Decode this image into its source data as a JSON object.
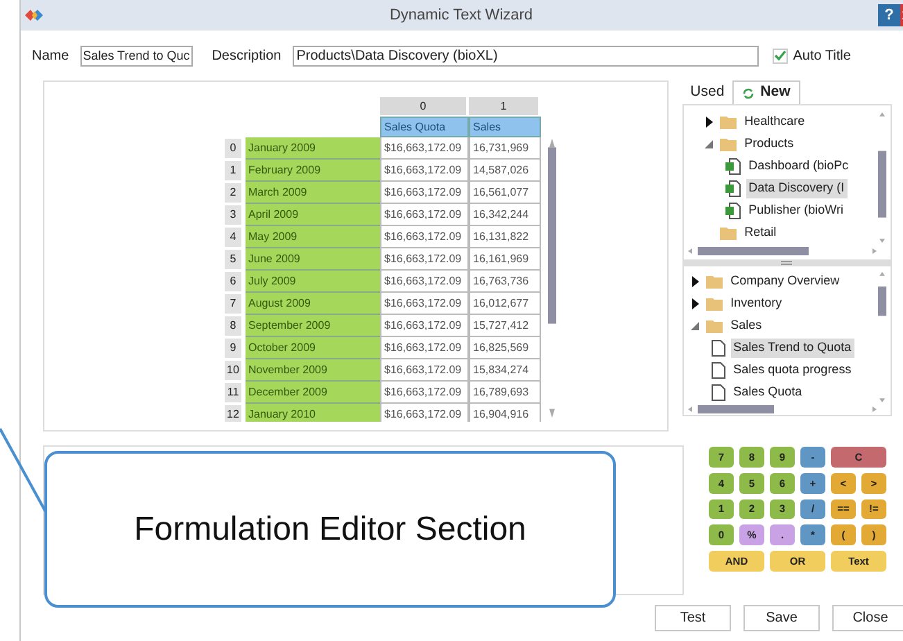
{
  "window": {
    "title": "Dynamic Text Wizard",
    "help": "?"
  },
  "form": {
    "name_label": "Name",
    "name_value": "Sales Trend to Quc",
    "description_label": "Description",
    "description_value": "Products\\Data Discovery (bioXL)",
    "auto_title": {
      "label": "Auto Title",
      "checked": true
    }
  },
  "table": {
    "column_numbers": [
      "0",
      "1"
    ],
    "columns": [
      "Sales Quota",
      "Sales"
    ],
    "rows": [
      {
        "index": "0",
        "label": "January 2009",
        "cells": [
          "$16,663,172.09",
          "16,731,969"
        ]
      },
      {
        "index": "1",
        "label": "February 2009",
        "cells": [
          "$16,663,172.09",
          "14,587,026"
        ]
      },
      {
        "index": "2",
        "label": "March 2009",
        "cells": [
          "$16,663,172.09",
          "16,561,077"
        ]
      },
      {
        "index": "3",
        "label": "April 2009",
        "cells": [
          "$16,663,172.09",
          "16,342,244"
        ]
      },
      {
        "index": "4",
        "label": "May 2009",
        "cells": [
          "$16,663,172.09",
          "16,131,822"
        ]
      },
      {
        "index": "5",
        "label": "June 2009",
        "cells": [
          "$16,663,172.09",
          "16,161,969"
        ]
      },
      {
        "index": "6",
        "label": "July 2009",
        "cells": [
          "$16,663,172.09",
          "16,763,736"
        ]
      },
      {
        "index": "7",
        "label": "August 2009",
        "cells": [
          "$16,663,172.09",
          "16,012,677"
        ]
      },
      {
        "index": "8",
        "label": "September 2009",
        "cells": [
          "$16,663,172.09",
          "15,727,412"
        ]
      },
      {
        "index": "9",
        "label": "October 2009",
        "cells": [
          "$16,663,172.09",
          "16,825,569"
        ]
      },
      {
        "index": "10",
        "label": "November 2009",
        "cells": [
          "$16,663,172.09",
          "15,834,274"
        ]
      },
      {
        "index": "11",
        "label": "December 2009",
        "cells": [
          "$16,663,172.09",
          "16,789,693"
        ]
      },
      {
        "index": "12",
        "label": "January 2010",
        "cells": [
          "$16,663,172.09",
          "16,904,916"
        ]
      }
    ]
  },
  "tabs": [
    {
      "label": "Used",
      "selected": false
    },
    {
      "label": "New",
      "selected": true
    }
  ],
  "tree_top": [
    {
      "label": "Healthcare",
      "kind": "folder",
      "expanded": false,
      "selected": false
    },
    {
      "label": "Products",
      "kind": "folder",
      "expanded": true,
      "selected": false,
      "children": [
        {
          "label": "Dashboard (bioPc",
          "kind": "report",
          "selected": false
        },
        {
          "label": "Data Discovery (I",
          "kind": "report",
          "selected": true
        },
        {
          "label": "Publisher (bioWri",
          "kind": "report",
          "selected": false
        }
      ]
    },
    {
      "label": "Retail",
      "kind": "folder",
      "selected": false
    }
  ],
  "tree_bottom": [
    {
      "label": "Company Overview",
      "kind": "folder",
      "expanded": false,
      "selected": false
    },
    {
      "label": "Inventory",
      "kind": "folder",
      "expanded": false,
      "selected": false
    },
    {
      "label": "Sales",
      "kind": "folder",
      "expanded": true,
      "selected": false,
      "children": [
        {
          "label": "Sales Trend to Quota",
          "kind": "document",
          "selected": true
        },
        {
          "label": "Sales quota progress",
          "kind": "document",
          "selected": false
        },
        {
          "label": "Sales Quota",
          "kind": "document",
          "selected": false
        }
      ]
    }
  ],
  "keypad": [
    {
      "label": "7",
      "kind": "digit"
    },
    {
      "label": "8",
      "kind": "digit"
    },
    {
      "label": "9",
      "kind": "digit"
    },
    {
      "label": "-",
      "kind": "operator"
    },
    {
      "label": "C",
      "kind": "clear"
    },
    {
      "label": "4",
      "kind": "digit"
    },
    {
      "label": "5",
      "kind": "digit"
    },
    {
      "label": "6",
      "kind": "digit"
    },
    {
      "label": "+",
      "kind": "operator"
    },
    {
      "label": "<",
      "kind": "compare"
    },
    {
      "label": ">",
      "kind": "compare"
    },
    {
      "label": "1",
      "kind": "digit"
    },
    {
      "label": "2",
      "kind": "digit"
    },
    {
      "label": "3",
      "kind": "digit"
    },
    {
      "label": "/",
      "kind": "operator"
    },
    {
      "label": "==",
      "kind": "compare"
    },
    {
      "label": "!=",
      "kind": "compare"
    },
    {
      "label": "0",
      "kind": "digit"
    },
    {
      "label": "%",
      "kind": "symbol"
    },
    {
      "label": ".",
      "kind": "symbol"
    },
    {
      "label": "*",
      "kind": "operator"
    },
    {
      "label": "(",
      "kind": "compare"
    },
    {
      "label": ")",
      "kind": "compare"
    },
    {
      "label": "AND",
      "kind": "logic"
    },
    {
      "label": "OR",
      "kind": "logic"
    },
    {
      "label": "Text",
      "kind": "logic"
    }
  ],
  "buttons": [
    "Test",
    "Save",
    "Close"
  ],
  "callout": {
    "text": "Formulation Editor Section"
  }
}
